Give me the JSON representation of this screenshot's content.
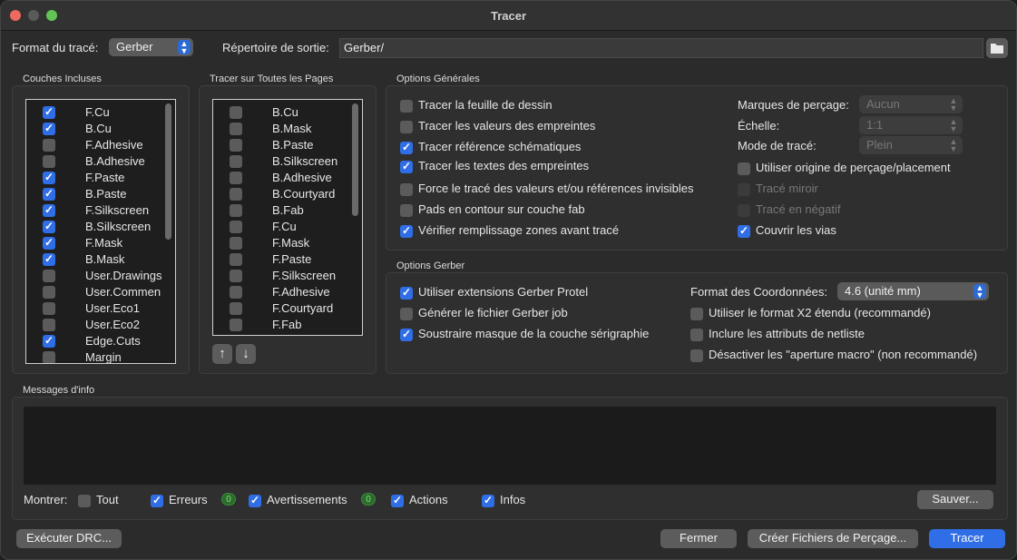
{
  "window": {
    "title": "Tracer"
  },
  "top": {
    "format_label": "Format du tracé:",
    "format_value": "Gerber",
    "output_dir_label": "Répertoire de sortie:",
    "output_dir_value": "Gerber/"
  },
  "couches": {
    "title": "Couches Incluses",
    "items": [
      {
        "label": "F.Cu",
        "checked": true
      },
      {
        "label": "B.Cu",
        "checked": true
      },
      {
        "label": "F.Adhesive",
        "checked": false
      },
      {
        "label": "B.Adhesive",
        "checked": false
      },
      {
        "label": "F.Paste",
        "checked": true
      },
      {
        "label": "B.Paste",
        "checked": true
      },
      {
        "label": "F.Silkscreen",
        "checked": true
      },
      {
        "label": "B.Silkscreen",
        "checked": true
      },
      {
        "label": "F.Mask",
        "checked": true
      },
      {
        "label": "B.Mask",
        "checked": true
      },
      {
        "label": "User.Drawings",
        "checked": false
      },
      {
        "label": "User.Commen",
        "checked": false
      },
      {
        "label": "User.Eco1",
        "checked": false
      },
      {
        "label": "User.Eco2",
        "checked": false
      },
      {
        "label": "Edge.Cuts",
        "checked": true
      },
      {
        "label": "Margin",
        "checked": false
      }
    ]
  },
  "pages": {
    "title": "Tracer sur Toutes les Pages",
    "items": [
      {
        "label": "B.Cu",
        "checked": false
      },
      {
        "label": "B.Mask",
        "checked": false
      },
      {
        "label": "B.Paste",
        "checked": false
      },
      {
        "label": "B.Silkscreen",
        "checked": false
      },
      {
        "label": "B.Adhesive",
        "checked": false
      },
      {
        "label": "B.Courtyard",
        "checked": false
      },
      {
        "label": "B.Fab",
        "checked": false
      },
      {
        "label": "F.Cu",
        "checked": false
      },
      {
        "label": "F.Mask",
        "checked": false
      },
      {
        "label": "F.Paste",
        "checked": false
      },
      {
        "label": "F.Silkscreen",
        "checked": false
      },
      {
        "label": "F.Adhesive",
        "checked": false
      },
      {
        "label": "F.Courtyard",
        "checked": false
      },
      {
        "label": "F.Fab",
        "checked": false
      }
    ],
    "up_icon": "arrow-up-icon",
    "down_icon": "arrow-down-icon"
  },
  "general": {
    "title": "Options Générales",
    "left": [
      {
        "label": "Tracer la feuille de dessin",
        "checked": false
      },
      {
        "label": "Tracer les valeurs des empreintes",
        "checked": false
      },
      {
        "label": "Tracer référence  schématiques",
        "checked": true
      },
      {
        "label": "Tracer les textes des empreintes",
        "checked": true
      },
      {
        "label": "Force le tracé des valeurs et/ou références invisibles",
        "checked": false
      },
      {
        "label": "Pads en contour sur couche fab",
        "checked": false
      },
      {
        "label": "Vérifier remplissage zones avant tracé",
        "checked": true
      }
    ],
    "drill_marks_label": "Marques de perçage:",
    "drill_marks_value": "Aucun",
    "scale_label": "Échelle:",
    "scale_value": "1:1",
    "mode_label": "Mode de tracé:",
    "mode_value": "Plein",
    "right": [
      {
        "label": "Utiliser origine de perçage/placement",
        "checked": false,
        "disabled": false
      },
      {
        "label": "Tracé miroir",
        "checked": false,
        "disabled": true
      },
      {
        "label": "Tracé en négatif",
        "checked": false,
        "disabled": true
      },
      {
        "label": "Couvrir les vias",
        "checked": true,
        "disabled": false
      }
    ]
  },
  "gerber": {
    "title": "Options Gerber",
    "left": [
      {
        "label": "Utiliser extensions Gerber Protel",
        "checked": true
      },
      {
        "label": "Générer le fichier Gerber job",
        "checked": false
      },
      {
        "label": "Soustraire masque de la couche sérigraphie",
        "checked": true
      }
    ],
    "coord_label": "Format des Coordonnées:",
    "coord_value": "4.6 (unité mm)",
    "right": [
      {
        "label": "Utiliser le format X2 étendu (recommandé)",
        "checked": false
      },
      {
        "label": "Inclure les attributs de netliste",
        "checked": false
      },
      {
        "label": "Désactiver les \"aperture macro\" (non recommandé)",
        "checked": false
      }
    ]
  },
  "messages": {
    "title": "Messages d'info",
    "show_label": "Montrer:",
    "filters": [
      {
        "label": "Tout",
        "checked": false,
        "badge": ""
      },
      {
        "label": "Erreurs",
        "checked": true,
        "badge": "0"
      },
      {
        "label": "Avertissements",
        "checked": true,
        "badge": "0"
      },
      {
        "label": "Actions",
        "checked": true,
        "badge": ""
      },
      {
        "label": "Infos",
        "checked": true,
        "badge": ""
      }
    ],
    "save_label": "Sauver..."
  },
  "footer": {
    "drc_label": "Exécuter DRC...",
    "close_label": "Fermer",
    "drill_files_label": "Créer Fichiers de Perçage...",
    "plot_label": "Tracer"
  },
  "colors": {
    "accent": "#2f6ee6",
    "badge_green": "#2b6b2b"
  }
}
